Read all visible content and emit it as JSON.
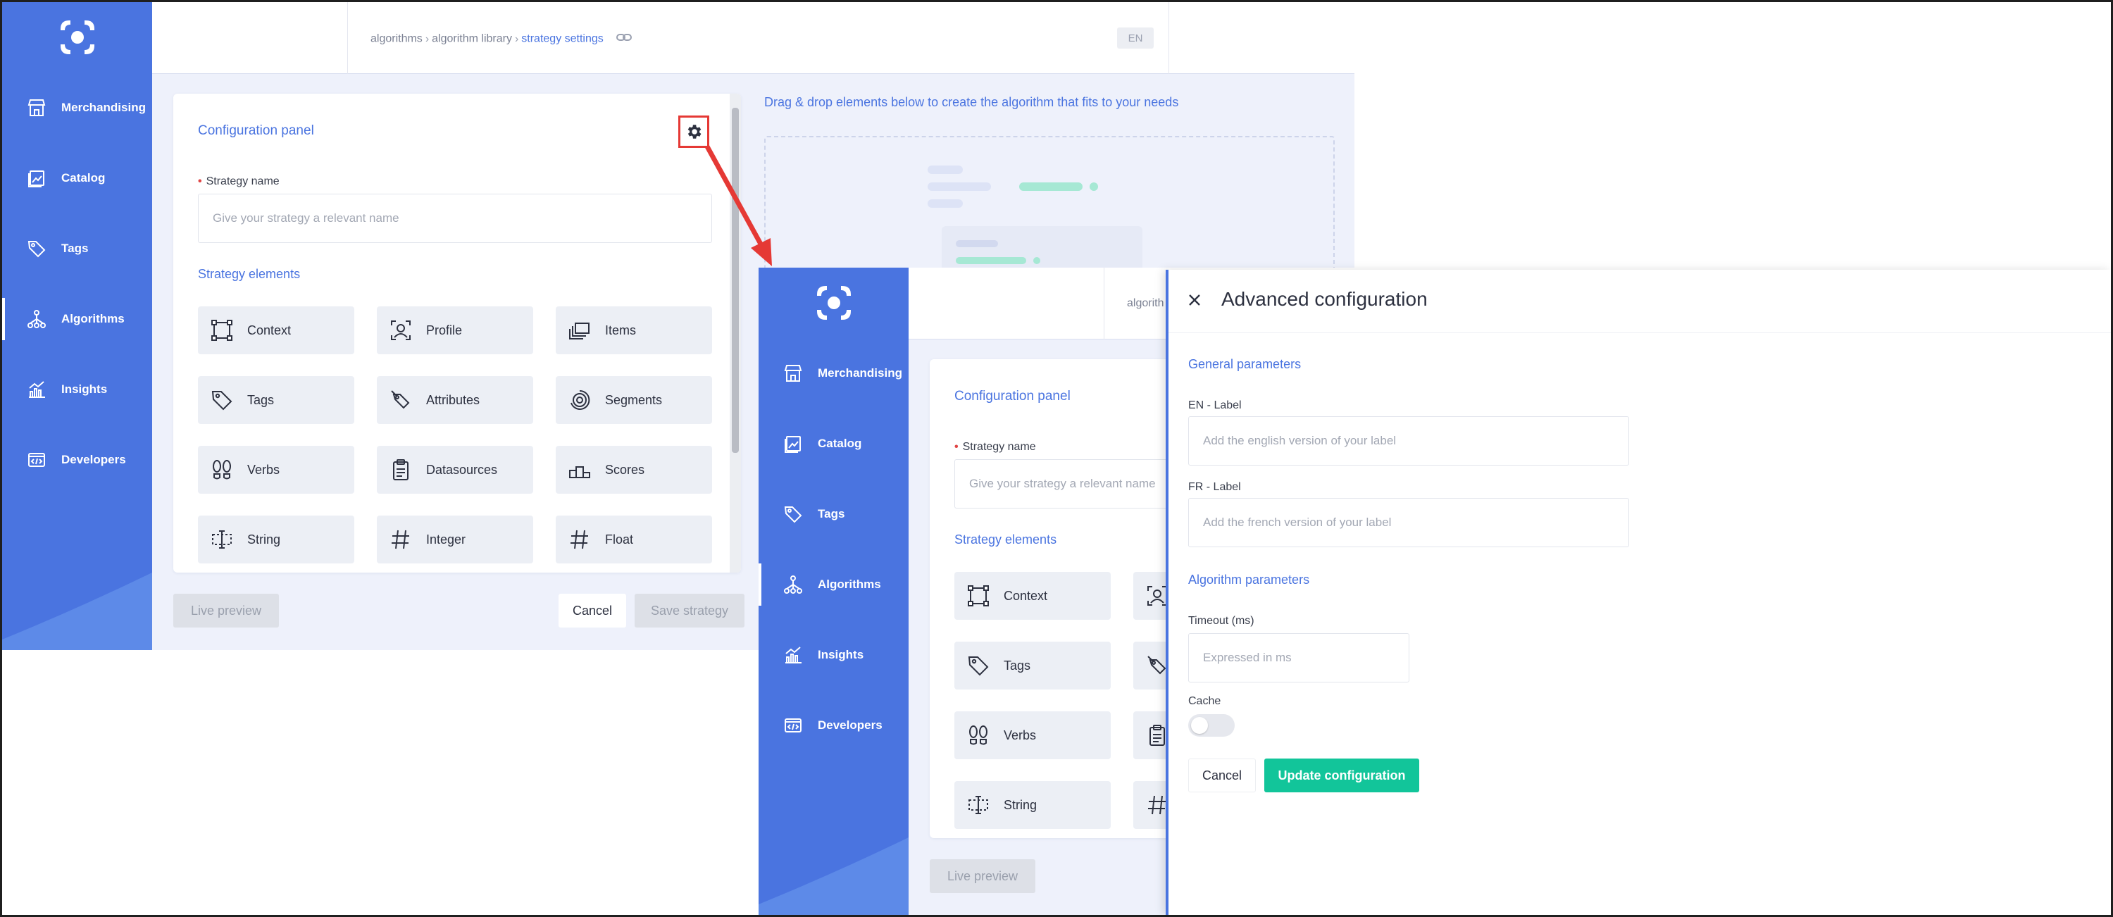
{
  "app": {
    "nav": [
      {
        "label": "Merchandising",
        "icon": "store-icon"
      },
      {
        "label": "Catalog",
        "icon": "catalog-icon"
      },
      {
        "label": "Tags",
        "icon": "tag-icon"
      },
      {
        "label": "Algorithms",
        "icon": "algorithm-icon"
      },
      {
        "label": "Insights",
        "icon": "insights-icon"
      },
      {
        "label": "Developers",
        "icon": "code-icon"
      }
    ],
    "active_nav": "Algorithms",
    "breadcrumb": {
      "part1": "algorithms",
      "part2": "algorithm library",
      "current": "strategy settings"
    },
    "lang": "EN",
    "config_panel": {
      "title": "Configuration panel",
      "strategy_name_label": "Strategy name",
      "strategy_name_placeholder": "Give your strategy a relevant name",
      "elements_title": "Strategy elements",
      "elements": [
        {
          "label": "Context",
          "icon": "context-icon"
        },
        {
          "label": "Profile",
          "icon": "profile-icon"
        },
        {
          "label": "Items",
          "icon": "items-icon"
        },
        {
          "label": "Tags",
          "icon": "tag-icon"
        },
        {
          "label": "Attributes",
          "icon": "attribute-icon"
        },
        {
          "label": "Segments",
          "icon": "segments-icon"
        },
        {
          "label": "Verbs",
          "icon": "footsteps-icon"
        },
        {
          "label": "Datasources",
          "icon": "clipboard-icon"
        },
        {
          "label": "Scores",
          "icon": "podium-icon"
        },
        {
          "label": "String",
          "icon": "text-cursor-icon"
        },
        {
          "label": "Integer",
          "icon": "hash-icon"
        },
        {
          "label": "Float",
          "icon": "hash-icon"
        }
      ]
    },
    "drop_hint": "Drag & drop elements below to create the algorithm that fits to your needs",
    "buttons": {
      "live_preview": "Live preview",
      "cancel": "Cancel",
      "save": "Save strategy"
    }
  },
  "second_view": {
    "breadcrumb_partial": "algorith",
    "top_right_partial": "."
  },
  "drawer": {
    "title": "Advanced configuration",
    "general_title": "General parameters",
    "en_label": "EN - Label",
    "en_placeholder": "Add the english version of your label",
    "fr_label": "FR - Label",
    "fr_placeholder": "Add the french version of your label",
    "algo_title": "Algorithm parameters",
    "timeout_label": "Timeout (ms)",
    "timeout_placeholder": "Expressed in ms",
    "cache_label": "Cache",
    "cache_enabled": false,
    "cancel": "Cancel",
    "update": "Update configuration"
  },
  "colors": {
    "primary": "#4a74e0",
    "success": "#12c59a",
    "highlight": "#e53935"
  }
}
